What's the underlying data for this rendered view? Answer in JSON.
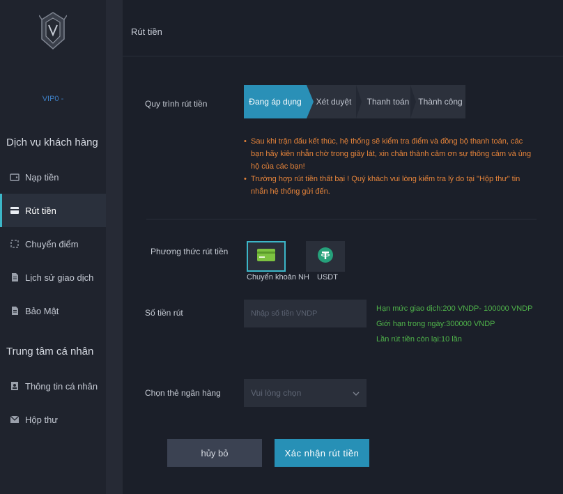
{
  "sidebar": {
    "vip": "VIP0 -",
    "customer_section": "Dịch vụ khách hàng",
    "personal_section": "Trung tâm cá nhân",
    "items": [
      {
        "label": "Nạp tiền",
        "icon": "wallet-icon"
      },
      {
        "label": "Rút tiền",
        "icon": "card-icon",
        "active": true
      },
      {
        "label": "Chuyển điểm",
        "icon": "transfer-icon"
      },
      {
        "label": "Lịch sử giao dịch",
        "icon": "document-icon"
      },
      {
        "label": "Bảo Mật",
        "icon": "document-icon"
      },
      {
        "label": "Thông tin cá nhân",
        "icon": "user-card-icon"
      },
      {
        "label": "Hộp thư",
        "icon": "mail-icon"
      }
    ]
  },
  "page": {
    "title": "Rút tiền",
    "process_label": "Quy trình rút tiền",
    "steps": [
      "Đang áp dụng",
      "Xét duyệt",
      "Thanh toán",
      "Thành công"
    ],
    "notes": [
      "Sau khi trận đấu kết thúc, hệ thống sẽ kiểm tra điểm và đồng bộ thanh toán, các bạn hãy kiên nhẫn chờ trong giây lát, xin chân thành cảm ơn sự thông cảm và ủng hộ của các bạn!",
      "Trường hợp rút tiền thất bại ! Quý khách vui lòng kiểm tra lý do tại \"Hộp thư\" tin nhắn hệ thống gửi đến."
    ],
    "method_label": "Phương thức rút tiền",
    "methods": [
      {
        "label": "Chuyển khoản NH",
        "selected": true
      },
      {
        "label": "USDT",
        "selected": false
      }
    ],
    "amount_label": "Số tiền rút",
    "amount_placeholder": "Nhập số tiền VNDP",
    "limits": [
      "Hạn mức giao dịch:200 VNDP- 100000 VNDP",
      "Giới hạn trong ngày:300000 VNDP",
      "Lần rút tiền còn lại:10 lần"
    ],
    "bank_label": "Chọn thẻ ngân hàng",
    "bank_placeholder": "Vui lòng chọn",
    "cancel_label": "hủy bỏ",
    "confirm_label": "Xác nhận rút tiền"
  },
  "colors": {
    "accent": "#2a90b7",
    "warning": "#e6843a",
    "success": "#4fb34a"
  }
}
